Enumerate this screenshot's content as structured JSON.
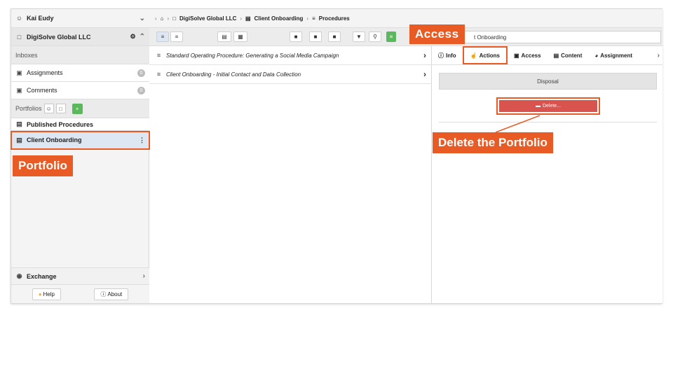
{
  "sidebar": {
    "user": "Kai Eudy",
    "org": "DigiSolve Global LLC",
    "inboxes": "Inboxes",
    "assignments": {
      "label": "Assignments",
      "count": "0"
    },
    "comments": {
      "label": "Comments",
      "count": "0"
    },
    "portfolios": "Portfolios",
    "published": "Published Procedures",
    "client_onboarding": "Client Onboarding",
    "exchange": "Exchange",
    "help": "Help",
    "about": "About"
  },
  "breadcrumb": [
    "DigiSolve Global LLC",
    "Client Onboarding",
    "Procedures"
  ],
  "search": {
    "value": "t Onboarding"
  },
  "list": [
    "Standard Operating Procedure: Generating a Social Media Campaign",
    "Client Onboarding - Initial Contact and Data Collection"
  ],
  "tabs": [
    "Info",
    "Actions",
    "Access",
    "Content",
    "Assignment"
  ],
  "panel": {
    "disposal": "Disposal",
    "delete": "Delete..."
  },
  "annotations": {
    "access": "Access",
    "portfolio": "Portfolio",
    "delete": "Delete the Portfolio"
  },
  "colors": {
    "accent": "#e95b25",
    "danger": "#d9534f",
    "selected": "#dde7f3"
  }
}
